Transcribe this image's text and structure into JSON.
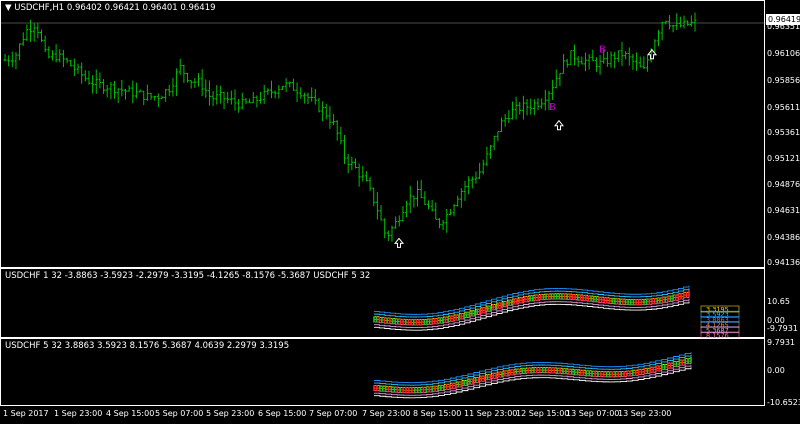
{
  "main": {
    "title": "USDCHF,H1  0.96402 0.96421 0.96401 0.96419",
    "menu_glyph": "▼",
    "current_price": "0.96419",
    "price_labels": [
      "0.96351",
      "0.96106",
      "0.95856",
      "0.95611",
      "0.95361",
      "0.95121",
      "0.94876",
      "0.94631",
      "0.94386",
      "0.94136"
    ],
    "bar_color": "#00c000",
    "marker_color": "#c000c0",
    "marker_label": "B"
  },
  "indicator1": {
    "title": "USDCHF 1 32 -3.8863 -3.5923 -2.2979 -3.3195 -4.1265 -8.1576 -5.3687  USDCHF 5 32",
    "scale_labels": [
      "10.65",
      "0.00",
      "-9.7931"
    ],
    "tag_labels": [
      "3.3195",
      "3.5923",
      "3.8863",
      "4.1265",
      "5.3687",
      "8.1576"
    ]
  },
  "indicator2": {
    "title": "USDCHF 5 32 3.8863 3.5923 8.1576 5.3687 4.0639 2.2979 3.3195",
    "scale_labels": [
      "9.7931",
      "0.00",
      "-10.6523"
    ]
  },
  "time_axis": [
    "1 Sep 2017",
    "1 Sep 23:00",
    "4 Sep 15:00",
    "5 Sep 07:00",
    "5 Sep 23:00",
    "6 Sep 15:00",
    "7 Sep 07:00",
    "7 Sep 23:00",
    "8 Sep 15:00",
    "11 Sep 23:00",
    "12 Sep 15:00",
    "13 Sep 07:00",
    "13 Sep 23:00"
  ],
  "chart_data": {
    "type": "ohlc",
    "symbol": "USDCHF",
    "timeframe": "H1",
    "ylim": [
      0.94136,
      0.96419
    ],
    "last": {
      "open": 0.96402,
      "high": 0.96421,
      "low": 0.96401,
      "close": 0.96419
    },
    "close_path": [
      0.9607,
      0.9611,
      0.9634,
      0.9642,
      0.9609,
      0.9611,
      0.9605,
      0.9597,
      0.9588,
      0.9584,
      0.9582,
      0.958,
      0.9577,
      0.9575,
      0.9572,
      0.9573,
      0.9581,
      0.96,
      0.9588,
      0.9585,
      0.9571,
      0.9572,
      0.9568,
      0.9565,
      0.9567,
      0.9573,
      0.9578,
      0.9584,
      0.9581,
      0.9576,
      0.9566,
      0.9559,
      0.9545,
      0.9515,
      0.9505,
      0.9492,
      0.9471,
      0.944,
      0.9454,
      0.9475,
      0.9481,
      0.947,
      0.9452,
      0.9462,
      0.948,
      0.9492,
      0.95,
      0.952,
      0.9545,
      0.9557,
      0.9562,
      0.9564,
      0.9568,
      0.958,
      0.96,
      0.9612,
      0.9607,
      0.9605,
      0.9603,
      0.961,
      0.9613,
      0.9605,
      0.9596,
      0.9625,
      0.9648,
      0.9638,
      0.964,
      0.9642
    ],
    "buy_arrows": [
      0.9434,
      0.9545,
      0.9612
    ],
    "b_markers": [
      0.956,
      0.9614
    ]
  }
}
